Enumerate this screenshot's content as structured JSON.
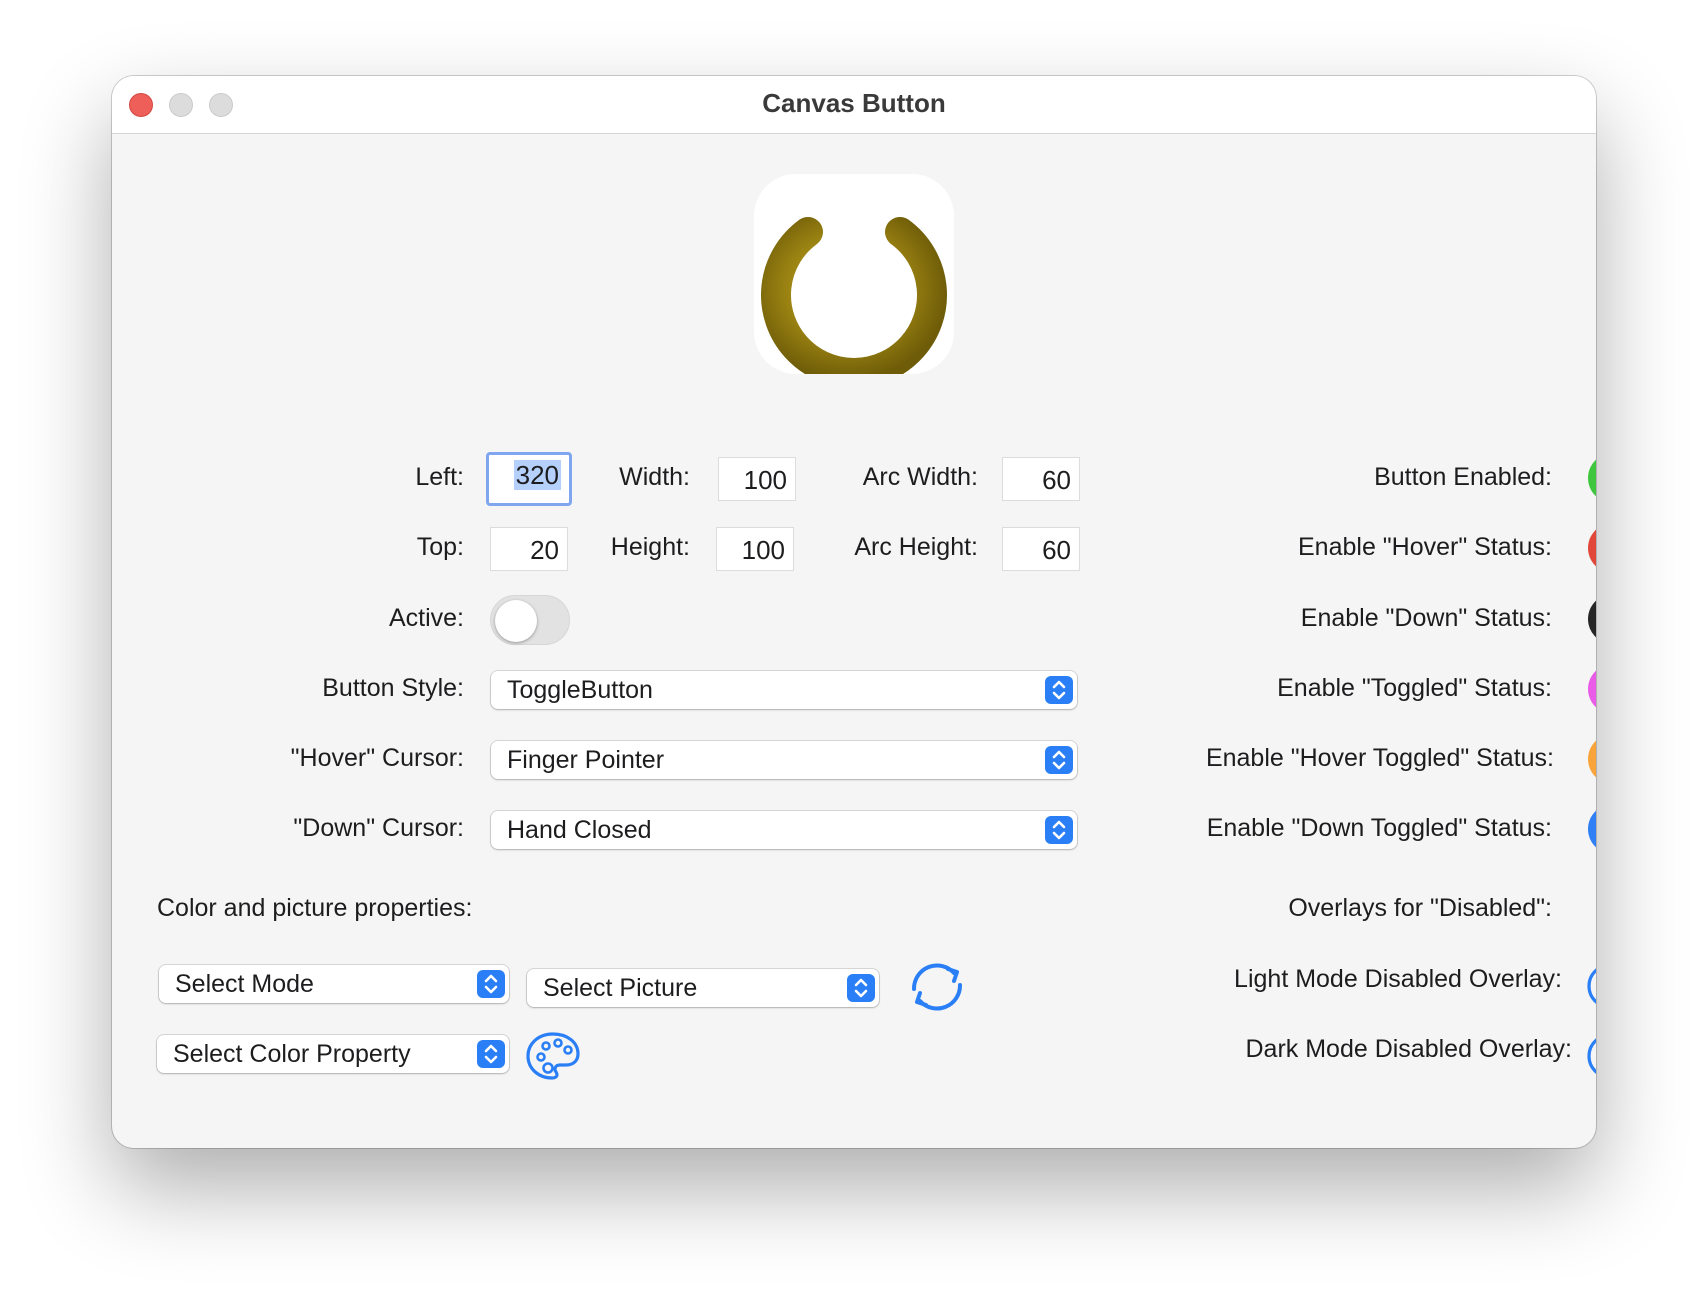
{
  "window": {
    "title": "Canvas Button"
  },
  "fields": {
    "left": {
      "label": "Left:",
      "value": "320"
    },
    "width": {
      "label": "Width:",
      "value": "100"
    },
    "arc_width": {
      "label": "Arc Width:",
      "value": "60"
    },
    "top": {
      "label": "Top:",
      "value": "20"
    },
    "height": {
      "label": "Height:",
      "value": "100"
    },
    "arc_height": {
      "label": "Arc Height:",
      "value": "60"
    }
  },
  "active": {
    "label": "Active:",
    "on": false
  },
  "popups": {
    "button_style": {
      "label": "Button Style:",
      "value": "ToggleButton"
    },
    "hover_cursor": {
      "label": "\"Hover\" Cursor:",
      "value": "Finger Pointer"
    },
    "down_cursor": {
      "label": "\"Down\" Cursor:",
      "value": "Hand Closed"
    },
    "select_mode": {
      "value": "Select Mode"
    },
    "select_picture": {
      "value": "Select Picture"
    },
    "select_color": {
      "value": "Select Color Property"
    }
  },
  "color_section_label": "Color and picture properties:",
  "overlays_label": "Overlays for \"Disabled\":",
  "toggles": [
    {
      "label": "Button Enabled:",
      "color": "#3ec73e",
      "on": true
    },
    {
      "label": "Enable \"Hover\" Status:",
      "color": "#e2483a",
      "on": true
    },
    {
      "label": "Enable \"Down\" Status:",
      "color": "#262626",
      "on": true
    },
    {
      "label": "Enable \"Toggled\" Status:",
      "color": "#ea5ce8",
      "on": true
    },
    {
      "label": "Enable \"Hover Toggled\" Status:",
      "color": "#f9a43a",
      "on": true
    },
    {
      "label": "Enable \"Down Toggled\" Status:",
      "color": "#2f7ff5",
      "on": true
    }
  ],
  "overlays": {
    "light": {
      "label": "Light Mode Disabled Overlay:",
      "icon": "palette-icon"
    },
    "dark": {
      "label": "Dark Mode Disabled Overlay:",
      "icon": "palette-icon"
    }
  },
  "colors": {
    "accent": "#2a7ff6",
    "power_icon": "#9a8212"
  }
}
